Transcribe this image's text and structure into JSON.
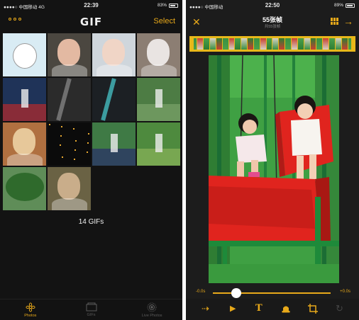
{
  "left_screen": {
    "status": {
      "carrier": "●●●●○ 中国移动  4G",
      "time": "22:39",
      "battery": "83%",
      "battery_level": 0.83
    },
    "logo": "GIF",
    "select_label": "Select",
    "gif_count": "14 GIFs",
    "tabs": [
      {
        "label": "Photos",
        "icon": "flower-icon",
        "active": true
      },
      {
        "label": "GIFs",
        "icon": "folder-icon",
        "active": false
      },
      {
        "label": "Live Photos",
        "icon": "live-photo-icon",
        "active": false
      }
    ],
    "thumbnails": [
      {
        "subject": "cartoon-cat-sticker",
        "bg": "#d9ecf4",
        "fg": "#ffffff"
      },
      {
        "subject": "woman-portrait",
        "bg": "#4b4740",
        "fg": "#e3b9a2"
      },
      {
        "subject": "woman-portrait",
        "bg": "#cfd6dc",
        "fg": "#f0d5c6"
      },
      {
        "subject": "woman-portrait",
        "bg": "#8c7e73",
        "fg": "#e9e4e2"
      },
      {
        "subject": "football-crowd",
        "bg": "#1f3358",
        "fg": "#b62a2b"
      },
      {
        "subject": "dark-abstract",
        "bg": "#2b2b2b",
        "fg": "#8f8f8f"
      },
      {
        "subject": "dark-abstract-cyan",
        "bg": "#1c2024",
        "fg": "#4ad2d6"
      },
      {
        "subject": "football-field",
        "bg": "#4d7c44",
        "fg": "#7aa36a"
      },
      {
        "subject": "blond-man",
        "bg": "#b07040",
        "fg": "#e7c89a"
      },
      {
        "subject": "night-sparkles",
        "bg": "#0b0b0b",
        "fg": "#e8a930"
      },
      {
        "subject": "soccer-player",
        "bg": "#3f7a45",
        "fg": "#2a2e6a"
      },
      {
        "subject": "soccer-match",
        "bg": "#4e8a3e",
        "fg": "#8ab35a"
      },
      {
        "subject": "trees",
        "bg": "#5f8d58",
        "fg": "#2f6a2c"
      },
      {
        "subject": "man-portrait",
        "bg": "#6a6244",
        "fg": "#c9ad8a"
      }
    ]
  },
  "right_screen": {
    "status": {
      "carrier": "●●●●○ 中国移动",
      "time": "22:50",
      "battery": "89%",
      "battery_level": 0.89
    },
    "title": "55张帧",
    "subtitle": "共55张帧",
    "speed_min": "-0.0s",
    "speed_max": "+0.0s",
    "speed_position": 0.2,
    "toolbar": [
      {
        "icon": "direction-arrow-icon"
      },
      {
        "icon": "play-icon"
      },
      {
        "icon": "text-icon"
      },
      {
        "icon": "stamp-icon"
      },
      {
        "icon": "crop-icon"
      },
      {
        "icon": "rotate-icon"
      }
    ],
    "colors": {
      "accent": "#e8a91a",
      "seat": "#e0241e",
      "frame": "#1e8a3a",
      "grass": "#3fa043"
    }
  }
}
